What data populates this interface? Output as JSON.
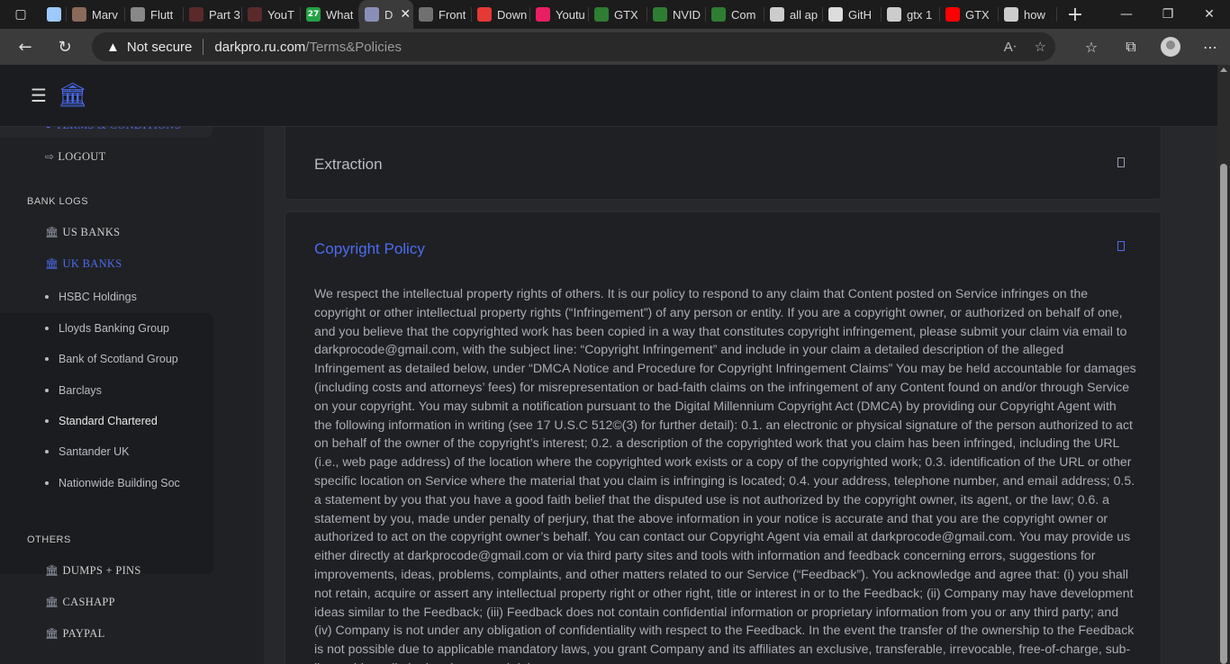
{
  "browser": {
    "tabs": [
      {
        "title": "Marv",
        "favicon": "avatar-favicon",
        "color": "#8a6a5a"
      },
      {
        "title": "Flutt",
        "favicon": "flutter-favicon",
        "color": "#888888"
      },
      {
        "title": "Part 3",
        "favicon": "youtube-dark-favicon",
        "color": "#5a2a2a"
      },
      {
        "title": "YouT",
        "favicon": "youtube-dark-favicon",
        "color": "#5a2a2a"
      },
      {
        "title": "What",
        "favicon": "whatsapp-favicon",
        "color": "#25a244",
        "badge": "27"
      },
      {
        "title": "D",
        "favicon": "site-favicon",
        "color": "#8a8fb8",
        "active": true
      },
      {
        "title": "Front",
        "favicon": "image-favicon",
        "color": "#707070"
      },
      {
        "title": "Down",
        "favicon": "download-favicon",
        "color": "#e53935"
      },
      {
        "title": "Youtu",
        "favicon": "download-pink-favicon",
        "color": "#e91e63"
      },
      {
        "title": "GTX",
        "favicon": "gpu-favicon",
        "color": "#2e7d32"
      },
      {
        "title": "NVID",
        "favicon": "chart-favicon",
        "color": "#2e7d32"
      },
      {
        "title": "Com",
        "favicon": "chart-favicon",
        "color": "#2e7d32"
      },
      {
        "title": "all ap",
        "favicon": "google-favicon",
        "color": "#cccccc"
      },
      {
        "title": "GitH",
        "favicon": "github-favicon",
        "color": "#dddddd"
      },
      {
        "title": "gtx 1",
        "favicon": "google-favicon",
        "color": "#cccccc"
      },
      {
        "title": "GTX",
        "favicon": "youtube-favicon",
        "color": "#ff0000"
      },
      {
        "title": "how",
        "favicon": "google-favicon",
        "color": "#cccccc"
      }
    ],
    "security_label": "Not secure",
    "url_host": "darkpro.ru.com",
    "url_path": "/Terms&Policies"
  },
  "sidebar": {
    "terms_label": "TERMS & CONDITIONS",
    "logout_label": "LOGOUT",
    "bank_logs_header": "BANK LOGS",
    "us_banks_label": "US BANKS",
    "uk_banks_label": "UK BANKS",
    "uk_banks": [
      "HSBC Holdings",
      "Lloyds Banking Group",
      "Bank of Scotland Group",
      "Barclays",
      "Standard Chartered",
      "Santander UK",
      "Nationwide Building Soc"
    ],
    "others_header": "OTHERS",
    "others": [
      "DUMPS + PINS",
      "CASHAPP",
      "PAYPAL"
    ]
  },
  "content": {
    "extraction_title": "Extraction",
    "copyright_title": "Copyright Policy",
    "copyright_body": "We respect the intellectual property rights of others. It is our policy to respond to any claim that Content posted on Service infringes on the copyright or other intellectual property rights (“Infringement”) of any person or entity. If you are a copyright owner, or authorized on behalf of one, and you believe that the copyrighted work has been copied in a way that constitutes copyright infringement, please submit your claim via email to darkprocode@gmail.com, with the subject line: “Copyright Infringement” and include in your claim a detailed description of the alleged Infringement as detailed below, under “DMCA Notice and Procedure for Copyright Infringement Claims” You may be held accountable for damages (including costs and attorneys’ fees) for misrepresentation or bad-faith claims on the infringement of any Content found on and/or through Service on your copyright. You may submit a notification pursuant to the Digital Millennium Copyright Act (DMCA) by providing our Copyright Agent with the following information in writing (see 17 U.S.C 512©(3) for further detail): 0.1. an electronic or physical signature of the person authorized to act on behalf of the owner of the copyright’s interest; 0.2. a description of the copyrighted work that you claim has been infringed, including the URL (i.e., web page address) of the location where the copyrighted work exists or a copy of the copyrighted work; 0.3. identification of the URL or other specific location on Service where the material that you claim is infringing is located; 0.4. your address, telephone number, and email address; 0.5. a statement by you that you have a good faith belief that the disputed use is not authorized by the copyright owner, its agent, or the law; 0.6. a statement by you, made under penalty of perjury, that the above information in your notice is accurate and that you are the copyright owner or authorized to act on the copyright owner’s behalf. You can contact our Copyright Agent via email at darkprocode@gmail.com. You may provide us either directly at darkprocode@gmail.com or via third party sites and tools with information and feedback concerning errors, suggestions for improvements, ideas, problems, complaints, and other matters related to our Service (“Feedback”). You acknowledge and agree that: (i) you shall not retain, acquire or assert any intellectual property right or other right, title or interest in or to the Feedback; (ii) Company may have development ideas similar to the Feedback; (iii) Feedback does not contain confidential information or proprietary information from you or any third party; and (iv) Company is not under any obligation of confidentiality with respect to the Feedback. In the event the transfer of the ownership to the Feedback is not possible due to applicable mandatory laws, you grant Company and its affiliates an exclusive, transferable, irrevocable, free-of-charge, sub-licensable, unlimited and perpetual right to"
  },
  "colors": {
    "accent": "#4b6cf0",
    "page_bg": "#27282c",
    "card_bg": "#1f2024",
    "sidebar_bg": "#202124"
  }
}
